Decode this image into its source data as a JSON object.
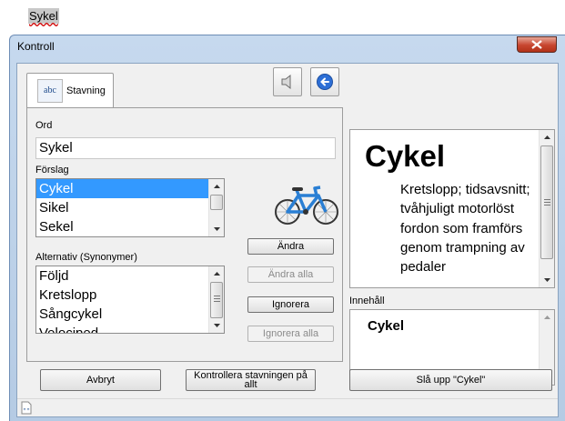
{
  "document": {
    "word": "Sykel"
  },
  "window": {
    "title": "Kontroll"
  },
  "tabs": [
    {
      "label": "Stavning",
      "icon_text": "abc"
    }
  ],
  "toolbar": {
    "speak_icon": "speaker-icon",
    "back_icon": "back-arrow-icon"
  },
  "word_field": {
    "label": "Ord",
    "value": "Sykel"
  },
  "suggestions": {
    "label": "Förslag",
    "items": [
      "Cykel",
      "Sikel",
      "Sekel"
    ],
    "selected": "Cykel"
  },
  "synonyms": {
    "label": "Alternativ (Synonymer)",
    "items": [
      "Följd",
      "Kretslopp",
      "Sångcykel",
      "Velociped"
    ]
  },
  "buttons": {
    "change": "Ändra",
    "change_all": "Ändra alla",
    "ignore": "Ignorera",
    "ignore_all": "Ignorera alla",
    "cancel": "Avbryt",
    "check_all": "Kontrollera stavningen på allt",
    "lookup": "Slå upp \"Cykel\""
  },
  "dictionary": {
    "headword": "Cykel",
    "definition": "Kretslopp; tidsavsnitt; tvåhjuligt motorlöst fordon som framförs genom trampning av pedaler"
  },
  "contents": {
    "label": "Innehåll",
    "item": "Cykel"
  },
  "colors": {
    "selection": "#3399ff",
    "bike": "#2a7fd4",
    "close": "#c7452f"
  }
}
